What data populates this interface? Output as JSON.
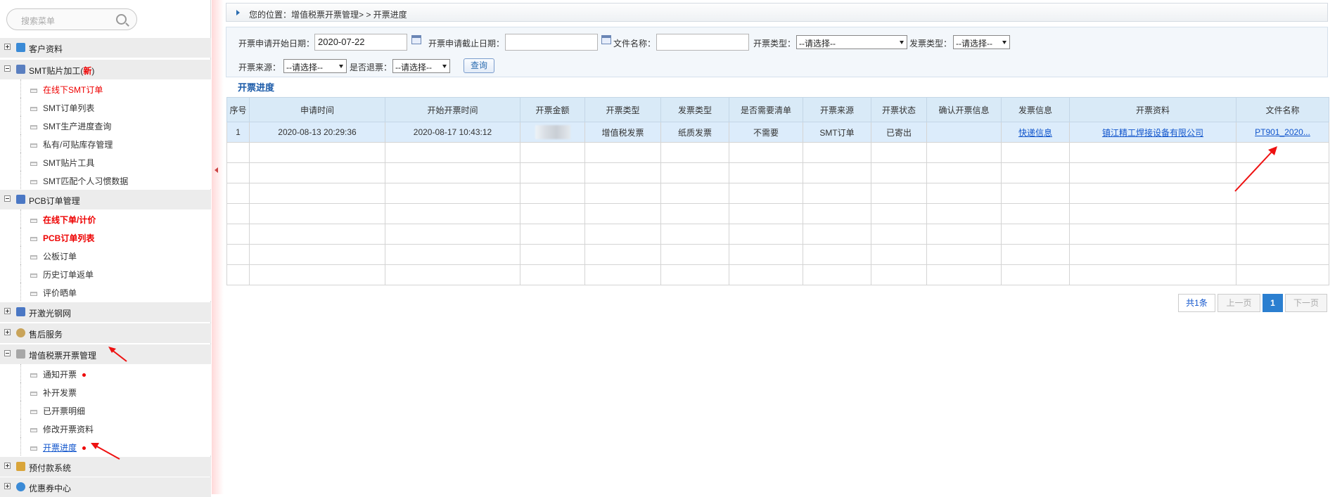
{
  "sidebar": {
    "search_placeholder": "搜索菜单",
    "groups": [
      {
        "label": "客户资料"
      },
      {
        "label": "SMT贴片加工(",
        "badge": "新",
        "suffix": ")"
      },
      {
        "label": "PCB订单管理"
      },
      {
        "label": "开激光钢网"
      },
      {
        "label": "售后服务"
      },
      {
        "label": "增值税票开票管理"
      },
      {
        "label": "预付款系统"
      },
      {
        "label": "优惠券中心"
      }
    ],
    "smt_items": [
      "在线下SMT订单",
      "SMT订单列表",
      "SMT生产进度查询",
      "私有/可贴库存管理",
      "SMT贴片工具",
      "SMT匹配个人习惯数据"
    ],
    "pcb_items": [
      "在线下单/计价",
      "PCB订单列表",
      "公板订单",
      "历史订单返单",
      "评价晒单"
    ],
    "vat_items": [
      "通知开票",
      "补开发票",
      "已开票明细",
      "修改开票资料",
      "开票进度"
    ]
  },
  "breadcrumb": {
    "text": "您的位置：增值税票开票管理> > 开票进度"
  },
  "filter": {
    "start_label": "开票申请开始日期：",
    "start_value": "2020-07-22",
    "end_label": "开票申请截止日期：",
    "end_value": "",
    "filename_label": "文件名称：",
    "filename_value": "",
    "type_label": "开票类型：",
    "type_value": "--请选择--",
    "invoice_type_label": "发票类型：",
    "invoice_type_value": "--请选择--",
    "source_label": "开票来源：",
    "source_value": "--请选择--",
    "refund_label": "是否退票：",
    "refund_value": "--请选择--",
    "query_button": "查询"
  },
  "section_title": "开票进度",
  "table": {
    "headers": [
      "序号",
      "申请时间",
      "开始开票时间",
      "开票金额",
      "开票类型",
      "发票类型",
      "是否需要清单",
      "开票来源",
      "开票状态",
      "确认开票信息",
      "发票信息",
      "开票资料",
      "文件名称"
    ],
    "rows": [
      {
        "no": "1",
        "apply_time": "2020-08-13 20:29:36",
        "start_time": "2020-08-17 10:43:12",
        "amount": "",
        "type": "增值税发票",
        "invoice_type": "纸质发票",
        "need_list": "不需要",
        "source": "SMT订单",
        "status": "已寄出",
        "confirm": "",
        "invoice_info": "快递信息",
        "company": "镇江精工焊接设备有限公司",
        "file": "PT901_2020..."
      }
    ]
  },
  "pager": {
    "total": "共1条",
    "prev": "上一页",
    "current": "1",
    "next": "下一页"
  },
  "colors": {
    "accent": "#2b7fd0",
    "header_bg": "#d9eaf7",
    "alert_red": "#e00000"
  }
}
